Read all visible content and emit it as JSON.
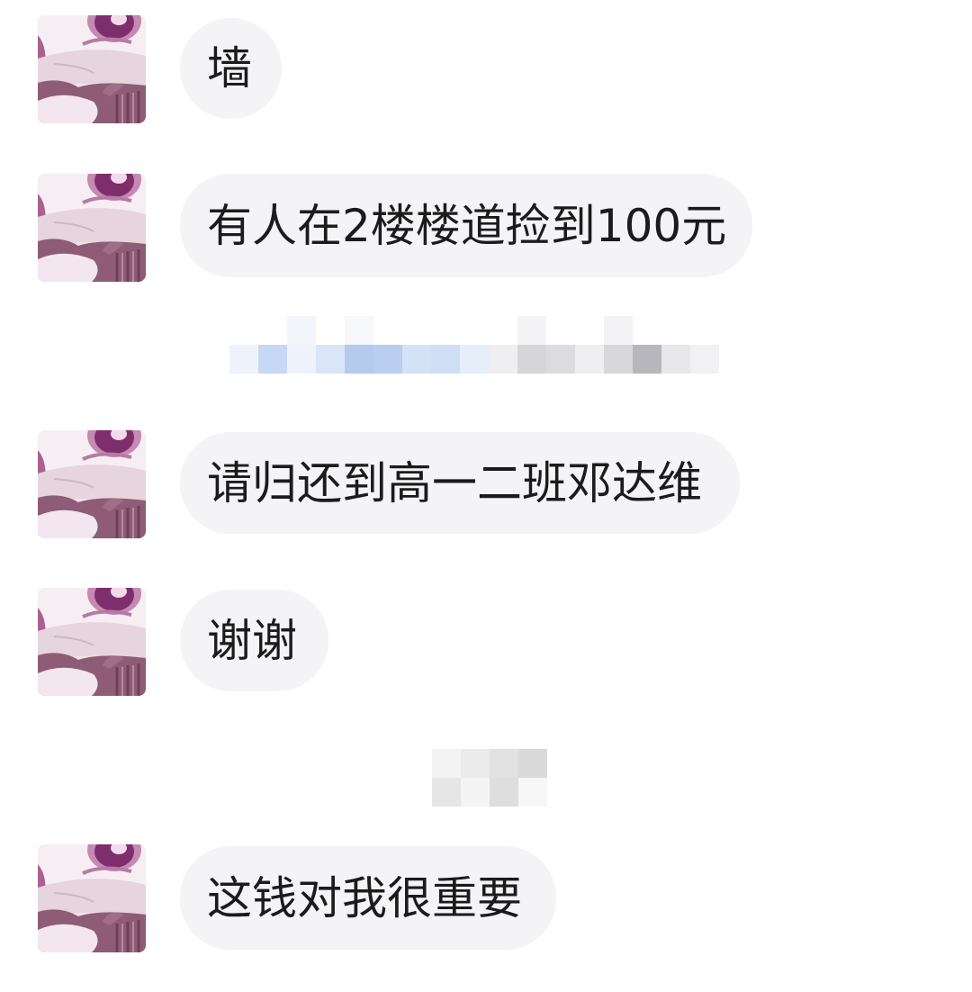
{
  "theme": {
    "page_bg": "#ffffff",
    "bubble_bg": "#f4f4f7",
    "text_color": "#1b1b1b"
  },
  "icons": {
    "avatar": "anime-character-avatar"
  },
  "messages": [
    {
      "text": "墙"
    },
    {
      "text": "有人在2楼楼道捡到100元"
    },
    {
      "text": "请归还到高一二班邓达维"
    },
    {
      "text": "谢谢"
    },
    {
      "text": "这钱对我很重要"
    }
  ],
  "redacted_blocks": [
    {
      "rows": [
        [
          "#ffffff",
          "#ffffff",
          "#f2f5fa",
          "#ffffff",
          "#f6f8fb",
          "#ffffff",
          "#ffffff",
          "#ffffff",
          "#ffffff",
          "#ffffff",
          "#f4f4f6",
          "#ffffff",
          "#ffffff",
          "#f3f3f5",
          "#ffffff",
          "#ffffff",
          "#ffffff"
        ],
        [
          "#eef3fb",
          "#c6d8f3",
          "#edf2fb",
          "#dae6f7",
          "#b5cbee",
          "#b9cef0",
          "#d4e2f5",
          "#cfdef5",
          "#e6eefa",
          "#efeff1",
          "#d6d6da",
          "#dcdce0",
          "#efeff1",
          "#d8d8dc",
          "#b7b7bd",
          "#e8e8eb",
          "#f1f1f3"
        ]
      ]
    },
    {
      "rows": [
        [
          "#f3f3f3",
          "#ebebeb",
          "#e2e2e2",
          "#dadada"
        ],
        [
          "#e6e6e6",
          "#f4f4f4",
          "#dedede",
          "#f6f6f6"
        ]
      ]
    }
  ]
}
